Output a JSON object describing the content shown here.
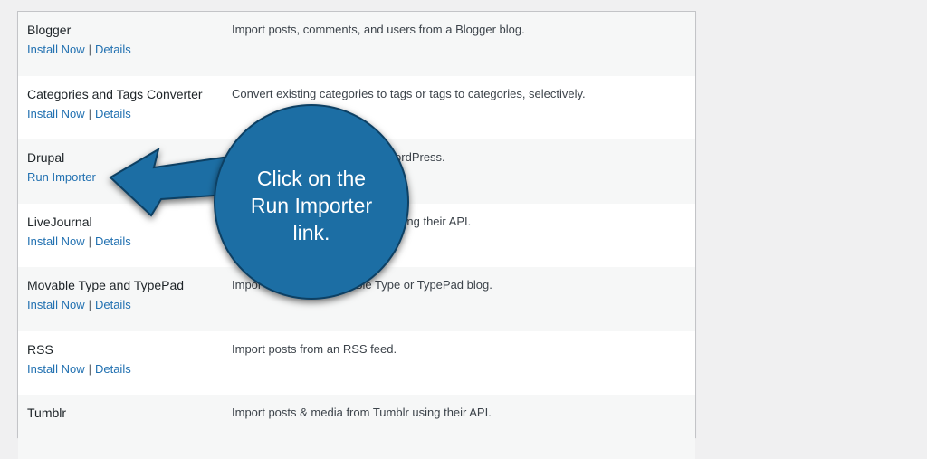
{
  "importers": [
    {
      "name": "Blogger",
      "actions": [
        "Install Now",
        "Details"
      ],
      "description": "Import posts, comments, and users from a Blogger blog."
    },
    {
      "name": "Categories and Tags Converter",
      "actions": [
        "Install Now",
        "Details"
      ],
      "description": "Convert existing categories to tags or tags to categories, selectively."
    },
    {
      "name": "Drupal",
      "actions": [
        "Run Importer"
      ],
      "description": "WordPress."
    },
    {
      "name": "LiveJournal",
      "actions": [
        "Install Now",
        "Details"
      ],
      "description": "sing their API."
    },
    {
      "name": "Movable Type and TypePad",
      "actions": [
        "Install Now",
        "Details"
      ],
      "description": "Impor ents from a Movable Type or TypePad blog."
    },
    {
      "name": "RSS",
      "actions": [
        "Install Now",
        "Details"
      ],
      "description": "Import posts from an RSS feed."
    },
    {
      "name": "Tumblr",
      "actions": [],
      "description": "Import posts & media from Tumblr using their API."
    }
  ],
  "separator": "|",
  "callout": {
    "lines": [
      "Click on the",
      "Run Importer",
      "link."
    ],
    "color": "#1c6ea4"
  },
  "colors": {
    "link": "#2271b1",
    "alt_row": "#f6f7f7",
    "page_bg": "#f0f0f1"
  }
}
